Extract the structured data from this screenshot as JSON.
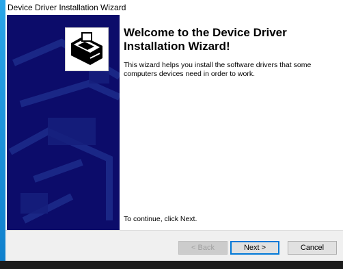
{
  "window": {
    "title": "Device Driver Installation Wizard"
  },
  "side_panel": {
    "logo_icon": "computer-drive-icon",
    "background_color": "#0c0c6a"
  },
  "content": {
    "heading": "Welcome to the Device Driver Installation Wizard!",
    "description": "This wizard helps you install the software drivers that some computers devices need in order to work.",
    "continue_text": "To continue, click Next."
  },
  "buttons": {
    "back_label": "< Back",
    "next_label": "Next >",
    "cancel_label": "Cancel"
  },
  "colors": {
    "accent": "#0078d7"
  }
}
